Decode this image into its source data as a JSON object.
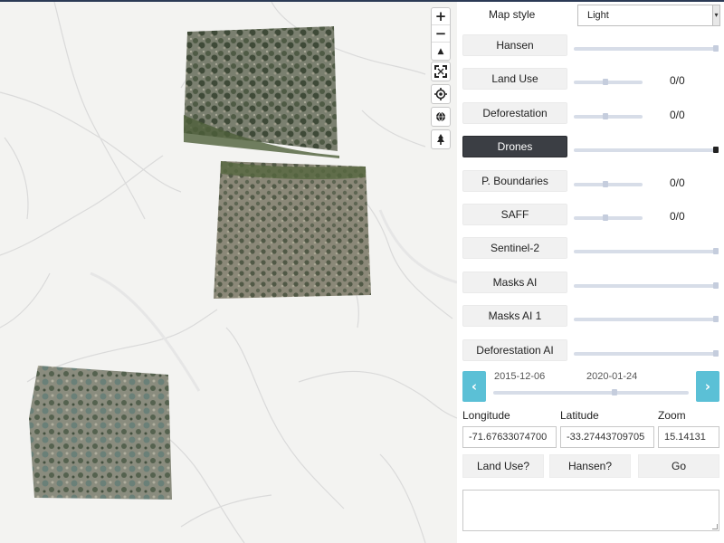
{
  "map": {
    "controls": {
      "zoom_in": "+",
      "zoom_out": "−",
      "compass": "▲",
      "fullscreen_icon": "fullscreen-icon",
      "locate_icon": "locate-icon",
      "globe_icon": "globe-icon",
      "tree_icon": "tree-icon"
    },
    "background_color": "#f3f3f1",
    "road_color": "#d6d6d6"
  },
  "panel": {
    "map_style": {
      "label": "Map style",
      "selected": "Light"
    },
    "layers": [
      {
        "label": "Hansen",
        "count": "",
        "opacity": 1.0,
        "active": false
      },
      {
        "label": "Land Use",
        "count": "0/0",
        "opacity": 0.45,
        "active": false
      },
      {
        "label": "Deforestation",
        "count": "0/0",
        "opacity": 0.45,
        "active": false
      },
      {
        "label": "Drones",
        "count": "",
        "opacity": 1.0,
        "active": true
      },
      {
        "label": "P. Boundaries",
        "count": "0/0",
        "opacity": 0.45,
        "active": false
      },
      {
        "label": "SAFF",
        "count": "0/0",
        "opacity": 0.45,
        "active": false
      },
      {
        "label": "Sentinel-2",
        "count": "",
        "opacity": 1.0,
        "active": false
      },
      {
        "label": "Masks AI",
        "count": "",
        "opacity": 1.0,
        "active": false
      },
      {
        "label": "Masks AI 1",
        "count": "",
        "opacity": 1.0,
        "active": false
      },
      {
        "label": "Deforestation AI",
        "count": "",
        "opacity": 1.0,
        "active": false
      }
    ],
    "timeline": {
      "start_date": "2015-12-06",
      "current_date": "2020-01-24",
      "prev_icon": "chevron-left-icon",
      "next_icon": "chevron-right-icon",
      "prev_glyph": "‹",
      "next_glyph": "›"
    },
    "coords": {
      "longitude_label": "Longitude",
      "latitude_label": "Latitude",
      "zoom_label": "Zoom",
      "longitude": "-71.67633074700",
      "latitude": "-33.27443709705",
      "zoom": "15.14131"
    },
    "actions": {
      "land_use": "Land Use?",
      "hansen": "Hansen?",
      "go": "Go"
    },
    "notes": ""
  },
  "colors": {
    "accent": "#5bc0d6",
    "active_button": "#3b3e44",
    "slider_track": "#d7dde8"
  }
}
